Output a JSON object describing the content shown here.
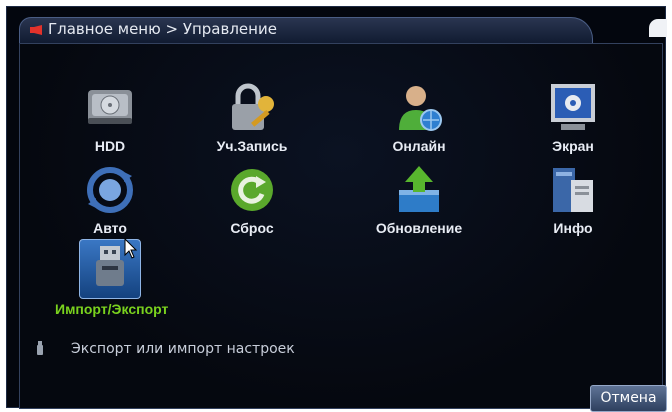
{
  "title": "Главное меню > Управление",
  "menu": [
    {
      "label": "HDD",
      "icon": "hdd-icon"
    },
    {
      "label": "Уч.Запись",
      "icon": "lock-key-icon"
    },
    {
      "label": "Онлайн",
      "icon": "online-user-icon"
    },
    {
      "label": "Экран",
      "icon": "screen-gear-icon"
    },
    {
      "label": "Авто",
      "icon": "auto-cycle-icon"
    },
    {
      "label": "Сброс",
      "icon": "reset-icon"
    },
    {
      "label": "Обновление",
      "icon": "upgrade-icon"
    },
    {
      "label": "Инфо",
      "icon": "info-icon"
    },
    {
      "label": "Импорт/Экспорт",
      "icon": "usb-icon",
      "selected": true
    }
  ],
  "hint": "Экспорт или импорт настроек",
  "buttons": {
    "cancel": "Отмена"
  },
  "colors": {
    "accent_green": "#7ad21e",
    "background": "#03060e",
    "title_text": "#e6eaf2"
  }
}
